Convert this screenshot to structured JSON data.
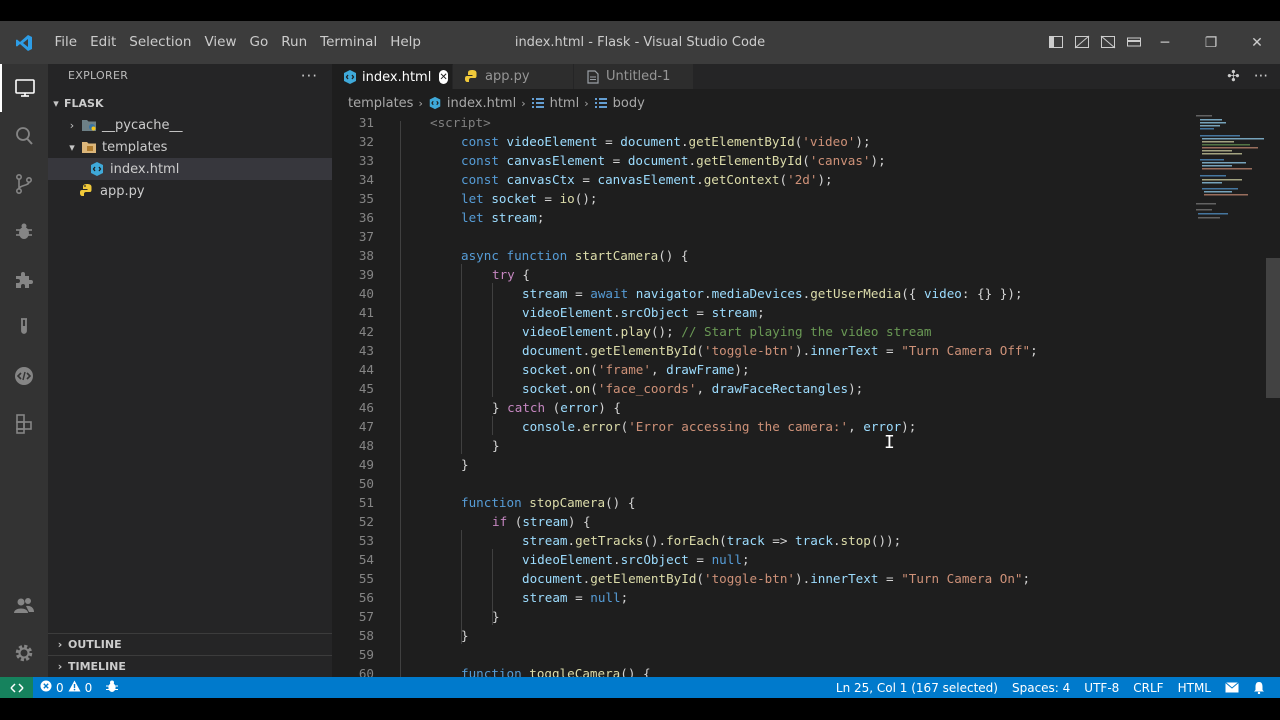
{
  "window": {
    "title": "index.html - Flask - Visual Studio Code",
    "menu": [
      "File",
      "Edit",
      "Selection",
      "View",
      "Go",
      "Run",
      "Terminal",
      "Help"
    ],
    "controls": {
      "minimize": "─",
      "restore": "❐",
      "close": "✕"
    }
  },
  "activity_bar": {
    "items": [
      "explorer-icon",
      "search-icon",
      "source-control-icon",
      "run-debug-icon",
      "extensions-icon",
      "testing-icon",
      "remote-icon",
      "docker-icon"
    ],
    "bottom": [
      "accounts-icon",
      "manage-gear-icon"
    ]
  },
  "sidebar": {
    "title": "EXPLORER",
    "more": "···",
    "folder": "FLASK",
    "tree": [
      {
        "label": "__pycache__",
        "type": "folder",
        "expanded": false
      },
      {
        "label": "templates",
        "type": "folder",
        "expanded": true
      },
      {
        "label": "index.html",
        "type": "html",
        "selected": true
      },
      {
        "label": "app.py",
        "type": "python"
      }
    ],
    "outline": "OUTLINE",
    "timeline": "TIMELINE"
  },
  "tabs": [
    {
      "label": "index.html",
      "active": true,
      "close": "✕"
    },
    {
      "label": "app.py",
      "active": false
    },
    {
      "label": "Untitled-1",
      "active": false
    }
  ],
  "breadcrumb": [
    "templates",
    "index.html",
    "html",
    "body"
  ],
  "code": {
    "current_line": 25,
    "lines": [
      {
        "n": "31",
        "text": "<script>"
      },
      {
        "n": "32",
        "text": "const videoElement = document.getElementById('video');"
      },
      {
        "n": "33",
        "text": "const canvasElement = document.getElementById('canvas');"
      },
      {
        "n": "34",
        "text": "const canvasCtx = canvasElement.getContext('2d');"
      },
      {
        "n": "35",
        "text": "let socket = io();"
      },
      {
        "n": "36",
        "text": "let stream;"
      },
      {
        "n": "37",
        "text": ""
      },
      {
        "n": "38",
        "text": "async function startCamera() {"
      },
      {
        "n": "39",
        "text": "try {"
      },
      {
        "n": "40",
        "text": "stream = await navigator.mediaDevices.getUserMedia({ video: {} });"
      },
      {
        "n": "41",
        "text": "videoElement.srcObject = stream;"
      },
      {
        "n": "42",
        "text": "videoElement.play(); // Start playing the video stream"
      },
      {
        "n": "43",
        "text": "document.getElementById('toggle-btn').innerText = \"Turn Camera Off\";"
      },
      {
        "n": "44",
        "text": "socket.on('frame', drawFrame);"
      },
      {
        "n": "45",
        "text": "socket.on('face_coords', drawFaceRectangles);"
      },
      {
        "n": "46",
        "text": "} catch (error) {"
      },
      {
        "n": "47",
        "text": "console.error('Error accessing the camera:', error);"
      },
      {
        "n": "48",
        "text": "}"
      },
      {
        "n": "49",
        "text": "}"
      },
      {
        "n": "50",
        "text": ""
      },
      {
        "n": "51",
        "text": "function stopCamera() {"
      },
      {
        "n": "52",
        "text": "if (stream) {"
      },
      {
        "n": "53",
        "text": "stream.getTracks().forEach(track => track.stop());"
      },
      {
        "n": "54",
        "text": "videoElement.srcObject = null;"
      },
      {
        "n": "55",
        "text": "document.getElementById('toggle-btn').innerText = \"Turn Camera On\";"
      },
      {
        "n": "56",
        "text": "stream = null;"
      },
      {
        "n": "57",
        "text": "}"
      },
      {
        "n": "58",
        "text": "}"
      },
      {
        "n": "59",
        "text": ""
      },
      {
        "n": "60",
        "text": "function toggleCamera() {"
      }
    ]
  },
  "statusbar": {
    "errors": "0",
    "warnings": "0",
    "position": "Ln 25, Col 1 (167 selected)",
    "spaces": "Spaces: 4",
    "encoding": "UTF-8",
    "eol": "CRLF",
    "language": "HTML"
  },
  "colors": {
    "status_bar": "#007acc",
    "remote": "#16825d",
    "editor_bg": "#1e1e1e",
    "sidebar_bg": "#252526",
    "activity_bg": "#333333",
    "titlebar_bg": "#3c3c3c"
  }
}
